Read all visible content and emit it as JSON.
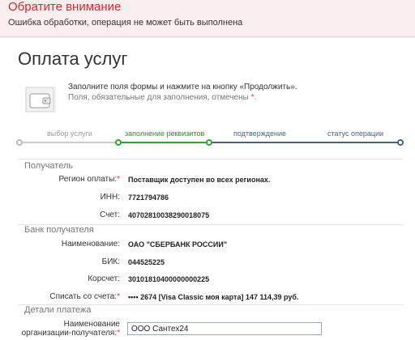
{
  "alert": {
    "title": "Обратите внимание",
    "message": "Ошибка обработки, операция не может быть выполнена"
  },
  "page": {
    "title": "Оплата услуг"
  },
  "info": {
    "line1": "Заполните поля формы и нажмите на кнопку «Продолжить».",
    "line2": "Поля, обязательные для заполнения, отмечены",
    "line2_star": "*",
    "line2_end": "."
  },
  "steps": [
    {
      "label": "выбор услуги",
      "state": "done"
    },
    {
      "label": "заполнение реквизитов",
      "state": "active"
    },
    {
      "label": "подтверждение",
      "state": "todo"
    },
    {
      "label": "статус операции",
      "state": "todo"
    }
  ],
  "colors": {
    "done": "#bbbbbb",
    "active": "#3aa13a",
    "todo": "#4a6280",
    "alert": "#cc2d2d"
  },
  "recipient": {
    "heading": "Получатель",
    "region_label": "Регион оплаты:",
    "region_star": "*",
    "region_value": "Поставщик доступен во всех регионах.",
    "inn_label": "ИНН:",
    "inn_value": "7721794786",
    "account_label": "Счет:",
    "account_value": "40702810038290018075"
  },
  "bank": {
    "heading": "Банк получателя",
    "name_label": "Наименование:",
    "name_value": "ОАО \"СБЕРБАНК РОССИИ\"",
    "bik_label": "БИК:",
    "bik_value": "044525225",
    "corr_label": "Корсчет:",
    "corr_value": "30101810400000000225",
    "debit_label": "Списать со счета:",
    "debit_star": "*",
    "debit_value": "•••• 2674  [Visa Classic моя карта] 147 114,39   руб."
  },
  "payment": {
    "heading": "Детали платежа",
    "org_label_line1": "Наименование",
    "org_label_line2": "организации-получателя:",
    "org_star": "*",
    "org_value": "ООО Сантех24"
  }
}
